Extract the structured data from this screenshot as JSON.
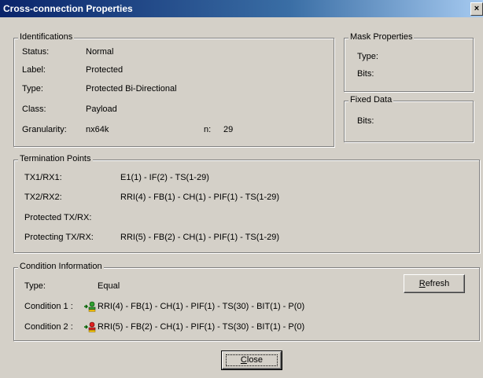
{
  "window": {
    "title": "Cross-connection Properties",
    "close_glyph": "×"
  },
  "identifications": {
    "legend": "Identifications",
    "rows": [
      {
        "label": "Status:",
        "value": "Normal"
      },
      {
        "label": "Label:",
        "value": "Protected"
      },
      {
        "label": "Type:",
        "value": "Protected Bi-Directional"
      },
      {
        "label": "Class:",
        "value": "Payload"
      },
      {
        "label": "Granularity:",
        "value": "nx64k"
      }
    ],
    "n_label": "n:",
    "n_value": "29"
  },
  "mask_properties": {
    "legend": "Mask Properties",
    "type_label": "Type:",
    "bits_label": "Bits:"
  },
  "fixed_data": {
    "legend": "Fixed Data",
    "bits_label": "Bits:"
  },
  "termination_points": {
    "legend": "Termination Points",
    "rows": [
      {
        "label": "TX1/RX1:",
        "value": "E1(1) - IF(2) - TS(1-29)"
      },
      {
        "label": "TX2/RX2:",
        "value": "RRI(4) - FB(1) - CH(1) - PIF(1) - TS(1-29)"
      },
      {
        "label": "Protected TX/RX:",
        "value": ""
      },
      {
        "label": "Protecting TX/RX:",
        "value": "RRI(5) - FB(2) - CH(1) - PIF(1) - TS(1-29)"
      }
    ]
  },
  "condition_information": {
    "legend": "Condition Information",
    "type_label": "Type:",
    "type_value": "Equal",
    "refresh_mnemonic": "R",
    "refresh_rest": "efresh",
    "conditions": [
      {
        "label": "Condition 1 :",
        "value": "RRI(4) - FB(1) - CH(1) - PIF(1) - TS(30) - BIT(1) - P(0)",
        "icon": "user-check-icon",
        "status_color": "#008000"
      },
      {
        "label": "Condition 2 :",
        "value": "RRI(5) - FB(2) - CH(1) - PIF(1) - TS(30) - BIT(1) - P(0)",
        "icon": "user-error-icon",
        "status_color": "#cc0000"
      }
    ]
  },
  "footer": {
    "close_mnemonic": "C",
    "close_rest": "lose"
  }
}
